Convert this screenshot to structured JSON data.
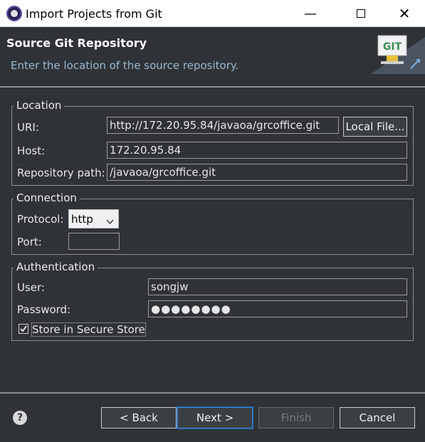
{
  "window": {
    "title": "Import Projects from Git"
  },
  "banner": {
    "title": "Source Git Repository",
    "description": "Enter the location of the source repository.",
    "logo_text": "GIT"
  },
  "location": {
    "legend": "Location",
    "uri_label": "URI:",
    "uri_value": "http://172.20.95.84/javaoa/grcoffice.git",
    "local_file_button": "Local File...",
    "host_label": "Host:",
    "host_value": "172.20.95.84",
    "path_label": "Repository path:",
    "path_value": "/javaoa/grcoffice.git"
  },
  "connection": {
    "legend": "Connection",
    "protocol_label": "Protocol:",
    "protocol_value": "http",
    "port_label": "Port:",
    "port_value": ""
  },
  "authentication": {
    "legend": "Authentication",
    "user_label": "User:",
    "user_value": "songjw",
    "password_label": "Password:",
    "password_value": "●●●●●●●●",
    "store_label": "Store in Secure Store",
    "store_checked": true
  },
  "buttons": {
    "back": "< Back",
    "next": "Next >",
    "finish": "Finish",
    "cancel": "Cancel"
  },
  "colors": {
    "background": "#2f3337",
    "accent": "#3d8bdc",
    "description": "#9ab7d1"
  }
}
